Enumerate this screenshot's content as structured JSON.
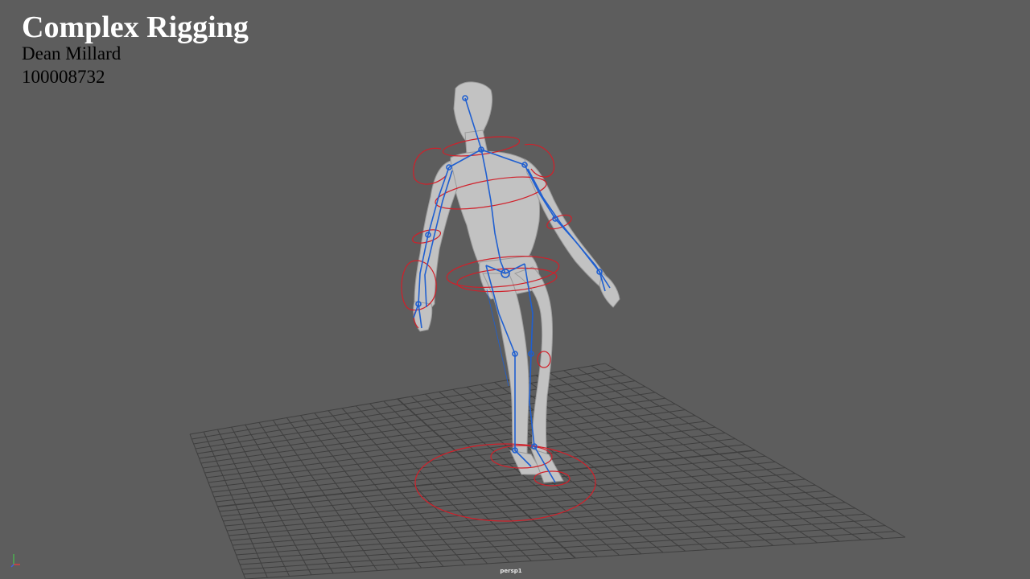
{
  "overlay": {
    "title": "Complex Rigging",
    "author": "Dean Millard",
    "student_id": "100008732"
  },
  "viewport": {
    "camera": "persp1",
    "background_color": "#5d5d5d",
    "grid_color": "#3f3f3f",
    "mesh_color": "#c4c4c4",
    "joint_color": "#1f5fd0",
    "control_color": "#d0202a"
  }
}
